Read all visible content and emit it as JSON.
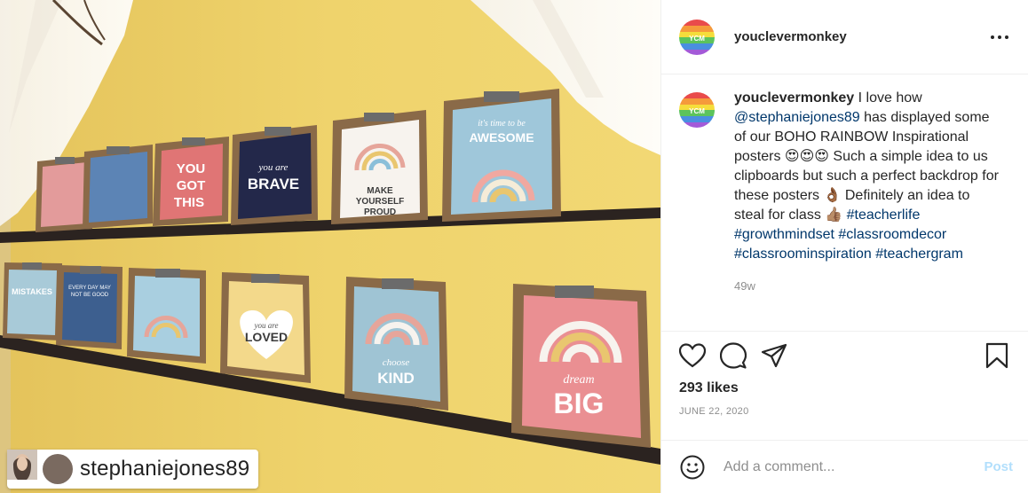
{
  "post": {
    "username": "youclevermonkey",
    "caption": {
      "username": "youclevermonkey",
      "text_before": " I love how ",
      "mention": "@stephaniejones89",
      "text_middle": " has displayed some of our BOHO RAINBOW Inspirational posters 😍😍😍 Such a simple idea to us clipboards but such a perfect backdrop for these posters 👌🏾 Definitely an idea to steal for class 👍🏽 ",
      "hashtags": [
        "#teacherlife",
        "#growthmindset",
        "#classroomdecor",
        "#classroominspiration",
        "#teachergram"
      ],
      "timestamp": "49w"
    },
    "likes": "293 likes",
    "date": "JUNE 22, 2020"
  },
  "photo": {
    "tagged_user": "stephaniejones89",
    "posters": {
      "top": [
        "YOU GOT THIS",
        "you are BRAVE",
        "MAKE YOURSELF PROUD",
        "it's time to be AWESOME"
      ],
      "bottom": [
        "MISTAKES",
        "EVERY DAY MAY NOT BE GOOD",
        "you are LOVED",
        "choose KIND",
        "dream BIG"
      ]
    }
  },
  "comment": {
    "placeholder": "Add a comment...",
    "post_label": "Post"
  },
  "colors": {
    "link": "#00376b",
    "post_disabled": "#b2dffc",
    "wall": "#e9c95a"
  },
  "icons": [
    "more-icon",
    "heart-icon",
    "comment-icon",
    "share-icon",
    "bookmark-icon",
    "emoji-icon",
    "person-icon"
  ]
}
